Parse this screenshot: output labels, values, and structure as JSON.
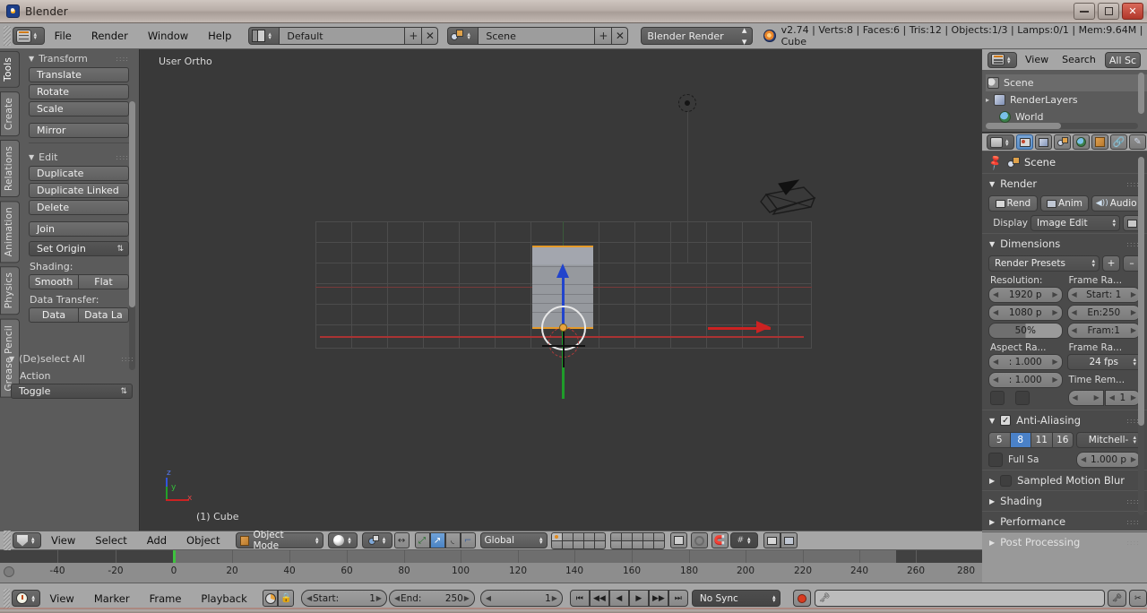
{
  "window": {
    "title": "Blender",
    "app_icon": "blender-logo-icon",
    "minimize": "–",
    "maximize": "▢",
    "close": "✕"
  },
  "info_header": {
    "editor_type_icon": "info-editor-icon",
    "menus": [
      "File",
      "Render",
      "Window",
      "Help"
    ],
    "screen_layout": {
      "icon": "screen-layout-icon",
      "value": "Default",
      "add": "+",
      "remove": "✕"
    },
    "scene": {
      "icon": "scene-icon",
      "value": "Scene",
      "add": "+",
      "remove": "✕"
    },
    "render_engine": "Blender Render",
    "stats": "v2.74 | Verts:8 | Faces:6 | Tris:12 | Objects:1/3 | Lamps:0/1 | Mem:9.64M | Cube"
  },
  "toolshelf": {
    "tabs": [
      "Tools",
      "Create",
      "Relations",
      "Animation",
      "Physics",
      "Grease Pencil"
    ],
    "active_tab": "Tools",
    "panels": [
      {
        "title": "Transform",
        "buttons": [
          "Translate",
          "Rotate",
          "Scale",
          "Mirror"
        ]
      },
      {
        "title": "Edit",
        "buttons": [
          "Duplicate",
          "Duplicate Linked",
          "Delete",
          "Join"
        ],
        "dropdown": "Set Origin",
        "shading_label": "Shading:",
        "shading_buttons": [
          "Smooth",
          "Flat"
        ],
        "data_transfer_label": "Data Transfer:",
        "data_transfer_buttons": [
          "Data",
          "Data La"
        ]
      },
      {
        "title": "(De)select All",
        "action_label": "Action",
        "action_value": "Toggle"
      }
    ]
  },
  "viewport": {
    "view_label": "User Ortho",
    "object_label": "(1) Cube",
    "axis_gizmo": {
      "x": "x",
      "y": "y",
      "z": "z"
    },
    "objects": [
      "cube-mesh",
      "lamp-object",
      "camera-object"
    ]
  },
  "outliner": {
    "editor_icon": "outliner-editor-icon",
    "menus": [
      "View",
      "Search"
    ],
    "display_mode": "All Sc",
    "rows": [
      {
        "label": "Scene",
        "icon": "scene-icon",
        "selected": true
      },
      {
        "label": "RenderLayers",
        "icon": "renderlayers-icon",
        "selected": false
      },
      {
        "label": "World",
        "icon": "world-icon",
        "selected": false
      }
    ]
  },
  "properties": {
    "editor_icon": "properties-editor-icon",
    "tabs": [
      "render-tab",
      "renderlayers-tab",
      "scene-tab",
      "world-tab",
      "object-tab",
      "constraints-tab",
      "modifiers-tab"
    ],
    "active_tab": "render-tab",
    "breadcrumb": {
      "pin_icon": "pin-icon",
      "scene_icon": "scene-icon",
      "label": "Scene"
    },
    "panels": [
      {
        "title": "Render",
        "buttons": [
          "Rend",
          "Anim",
          "Audio"
        ],
        "display_label": "Display",
        "display_value": "Image Edit"
      },
      {
        "title": "Dimensions",
        "presets": "Render Presets",
        "preset_add": "+",
        "preset_remove": "–",
        "resolution_label": "Resolution:",
        "resolution_x": "1920 p",
        "resolution_y": "1080 p",
        "resolution_percent": "50%",
        "frame_range_label": "Frame Ra...",
        "frame_start": "Start: 1",
        "frame_end": "En:250",
        "frame_step": "Fram:1",
        "aspect_label": "Aspect Ra...",
        "aspect_x": ": 1.000",
        "aspect_y": ": 1.000",
        "frame_rate_label": "Frame Ra...",
        "frame_rate": "24 fps",
        "time_remap_label": "Time Rem...",
        "time_remap_old": "",
        "time_remap_new": "1"
      },
      {
        "title": "Anti-Aliasing",
        "checked": true,
        "samples": [
          "5",
          "8",
          "11",
          "16"
        ],
        "active_sample": "8",
        "filter": "Mitchell-",
        "full_sample_label": "Full Sa",
        "filter_size": "1.000 p"
      },
      {
        "title": "Sampled Motion Blur",
        "collapsed": true,
        "has_checkbox": true
      },
      {
        "title": "Shading",
        "collapsed": true
      },
      {
        "title": "Performance",
        "collapsed": true
      },
      {
        "title": "Post Processing",
        "collapsed": true
      }
    ]
  },
  "view3d_footer": {
    "editor_icon": "view3d-editor-icon",
    "menus": [
      "View",
      "Select",
      "Add",
      "Object"
    ],
    "mode": "Object Mode",
    "mode_icon": "object-mode-icon",
    "shading_icon": "solid-shading-icon",
    "pivot_icon": "pivot-median-icon",
    "manipulator_icons": [
      "translate-manipulator-icon",
      "rotate-manipulator-icon",
      "scale-manipulator-icon"
    ],
    "transform_orientation": "Global",
    "layers_label": "scene-layers",
    "extra_icons": [
      "render-only-icon",
      "proportional-edit-icon",
      "snap-magnet-icon",
      "snap-element-icon",
      "render-preview-icon",
      "render-animation-icon"
    ]
  },
  "timeline": {
    "editor_icon": "timeline-editor-icon",
    "menus": [
      "View",
      "Marker",
      "Frame",
      "Playback"
    ],
    "toggles": [
      "auto-keyframe-icon",
      "lock-icon"
    ],
    "start_label": "Start:",
    "start_value": "1",
    "end_label": "End:",
    "end_value": "250",
    "current_frame": "1",
    "transport": [
      "jump-to-start-icon",
      "step-back-icon",
      "play-reverse-icon",
      "play-icon",
      "step-forward-icon",
      "jump-to-end-icon"
    ],
    "sync_mode": "No Sync",
    "record_icon": "record-icon",
    "keying_set_icon": "keying-set-icon",
    "keying_set_value": "",
    "keying_add_icon": "key-add-icon",
    "keying_remove_icon": "key-remove-icon",
    "ruler_ticks": [
      "-40",
      "-20",
      "0",
      "20",
      "40",
      "60",
      "80",
      "100",
      "120",
      "140",
      "160",
      "180",
      "200",
      "220",
      "240",
      "260",
      "280"
    ],
    "playhead_frame": "1"
  },
  "colors": {
    "accent_blue": "#4a81c8",
    "selection_orange": "#e59a2a",
    "header_gray": "#a6a6a6",
    "panel_gray": "#4a4a4a",
    "viewport_bg": "#393939",
    "axis_x": "#cc2222",
    "axis_y": "#1f9c2a",
    "axis_z": "#2244cc"
  }
}
